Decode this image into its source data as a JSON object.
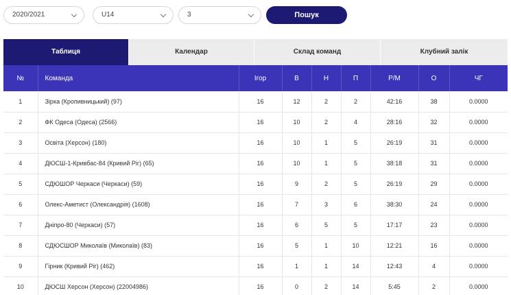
{
  "filters": {
    "season": "2020/2021",
    "age": "U14",
    "group": "3",
    "search_label": "Пошук"
  },
  "tabs": [
    {
      "label": "Таблиця",
      "active": true
    },
    {
      "label": "Календар",
      "active": false
    },
    {
      "label": "Склад команд",
      "active": false
    },
    {
      "label": "Клубний залік",
      "active": false
    }
  ],
  "table": {
    "headers": [
      "№",
      "Команда",
      "Ігор",
      "В",
      "Н",
      "П",
      "Р/М",
      "О",
      "ЧГ"
    ],
    "rows": [
      [
        "1",
        "Зірка (Кропивницький) (97)",
        "16",
        "12",
        "2",
        "2",
        "42:16",
        "38",
        "0.0000"
      ],
      [
        "2",
        "ФК Одеса (Одеса) (2566)",
        "16",
        "10",
        "2",
        "4",
        "28:16",
        "32",
        "0.0000"
      ],
      [
        "3",
        "Освіта (Херсон) (180)",
        "16",
        "10",
        "1",
        "5",
        "26:19",
        "31",
        "0.0000"
      ],
      [
        "4",
        "ДЮСШ-1-Кривбас-84 (Кривий Ріг) (65)",
        "16",
        "10",
        "1",
        "5",
        "38:18",
        "31",
        "0.0000"
      ],
      [
        "5",
        "СДЮШОР Черкаси (Черкаси) (59)",
        "16",
        "9",
        "2",
        "5",
        "26:19",
        "29",
        "0.0000"
      ],
      [
        "6",
        "Олекс-Аметист (Олександрія) (1608)",
        "16",
        "7",
        "3",
        "6",
        "38:30",
        "24",
        "0.0000"
      ],
      [
        "7",
        "Дніпро-80 (Черкаси) (57)",
        "16",
        "6",
        "5",
        "5",
        "17:17",
        "23",
        "0.0000"
      ],
      [
        "8",
        "СДЮСШОР Миколаїв (Миколаїв) (83)",
        "16",
        "5",
        "1",
        "10",
        "12:21",
        "16",
        "0.0000"
      ],
      [
        "9",
        "Гірник (Кривий Ріг) (462)",
        "16",
        "1",
        "1",
        "14",
        "12:43",
        "4",
        "0.0000"
      ],
      [
        "10",
        "ДЮСШ Херсон (Херсон) (22004986)",
        "16",
        "0",
        "2",
        "14",
        "5:45",
        "2",
        "0.0000"
      ]
    ]
  }
}
